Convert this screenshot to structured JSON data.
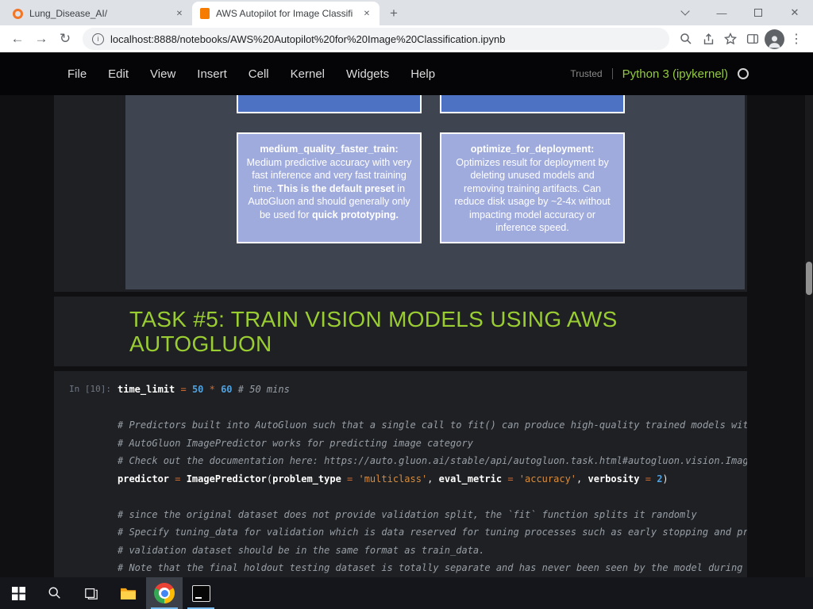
{
  "browser": {
    "tabs": [
      {
        "title": "Lung_Disease_AI/"
      },
      {
        "title": "AWS Autopilot for Image Classifi"
      }
    ],
    "url": "localhost:8888/notebooks/AWS%20Autopilot%20for%20Image%20Classification.ipynb",
    "glyphs": {
      "plus": "+",
      "tab_close": "✕",
      "minimize": "—",
      "close": "✕",
      "kebab": "⋮",
      "back": "←",
      "forward": "→",
      "reload": "↻",
      "info": "i"
    }
  },
  "notebook": {
    "menu_items": [
      "File",
      "Edit",
      "View",
      "Insert",
      "Cell",
      "Kernel",
      "Widgets",
      "Help"
    ],
    "trusted_label": "Trusted",
    "kernel_name": "Python 3 (ipykernel)",
    "preset_cards": {
      "left": {
        "title": "medium_quality_faster_train:",
        "body": [
          {
            "text": "Medium predictive accuracy with very fast inference and very fast training time. ",
            "bold": false
          },
          {
            "text": "This is the default preset",
            "bold": true
          },
          {
            "text": " in AutoGluon and should generally only be used for ",
            "bold": false
          },
          {
            "text": "quick prototyping.",
            "bold": true
          }
        ]
      },
      "right": {
        "title": "optimize_for_deployment:",
        "body": [
          {
            "text": "Optimizes result for deployment by deleting unused models and removing training artifacts. Can reduce disk usage by ~2-4x without impacting model accuracy or inference speed.",
            "bold": false
          }
        ]
      }
    },
    "heading": "TASK #5: TRAIN VISION MODELS USING AWS AUTOGLUON",
    "code_cell": {
      "prompt": "In [10]:",
      "lines": [
        {
          "segments": [
            {
              "t": "time_limit ",
              "c": "nm"
            },
            {
              "t": "= ",
              "c": "op"
            },
            {
              "t": "50",
              "c": "num"
            },
            {
              "t": " ",
              "c": "pl"
            },
            {
              "t": "* ",
              "c": "op"
            },
            {
              "t": "60 ",
              "c": "num"
            },
            {
              "t": "# 50 mins",
              "c": "cm"
            }
          ]
        },
        {
          "segments": []
        },
        {
          "segments": [
            {
              "t": "# Predictors built into AutoGluon such that a single call to fit() can produce high-quality trained models with images",
              "c": "cm"
            }
          ]
        },
        {
          "segments": [
            {
              "t": "# AutoGluon ImagePredictor works for predicting image category",
              "c": "cm"
            }
          ]
        },
        {
          "segments": [
            {
              "t": "# Check out the documentation here: https://auto.gluon.ai/stable/api/autogluon.task.html#autogluon.vision.ImagePredictor",
              "c": "cm"
            }
          ]
        },
        {
          "segments": [
            {
              "t": "predictor ",
              "c": "nm"
            },
            {
              "t": "= ",
              "c": "op"
            },
            {
              "t": "ImagePredictor",
              "c": "nm"
            },
            {
              "t": "(",
              "c": "pl"
            },
            {
              "t": "problem_type ",
              "c": "nm"
            },
            {
              "t": "= ",
              "c": "op"
            },
            {
              "t": "'multiclass'",
              "c": "str"
            },
            {
              "t": ", ",
              "c": "pl"
            },
            {
              "t": "eval_metric ",
              "c": "nm"
            },
            {
              "t": "= ",
              "c": "op"
            },
            {
              "t": "'accuracy'",
              "c": "str"
            },
            {
              "t": ", ",
              "c": "pl"
            },
            {
              "t": "verbosity ",
              "c": "nm"
            },
            {
              "t": "= ",
              "c": "op"
            },
            {
              "t": "2",
              "c": "num"
            },
            {
              "t": ")",
              "c": "pl"
            }
          ]
        },
        {
          "segments": []
        },
        {
          "segments": [
            {
              "t": "# since the original dataset does not provide validation split, the `fit` function splits it randomly",
              "c": "cm"
            }
          ]
        },
        {
          "segments": [
            {
              "t": "# Specify tuning_data for validation which is data reserved for tuning processes such as early stopping and pruning",
              "c": "cm"
            }
          ]
        },
        {
          "segments": [
            {
              "t": "# validation dataset should be in the same format as train_data.",
              "c": "cm"
            }
          ]
        },
        {
          "segments": [
            {
              "t": "# Note that the final holdout testing dataset is totally separate and has never been seen by the model during training",
              "c": "cm"
            }
          ]
        }
      ]
    }
  },
  "colors": {
    "heading_green": "#9acd32",
    "kernel_green": "#93c940",
    "card_light_blue": "#a0abdd",
    "card_dark_blue": "#4d71c3",
    "panel_gray": "#3e4450",
    "taskbar_accent": "#76b9ed",
    "jupyter_orange": "#f37626"
  }
}
